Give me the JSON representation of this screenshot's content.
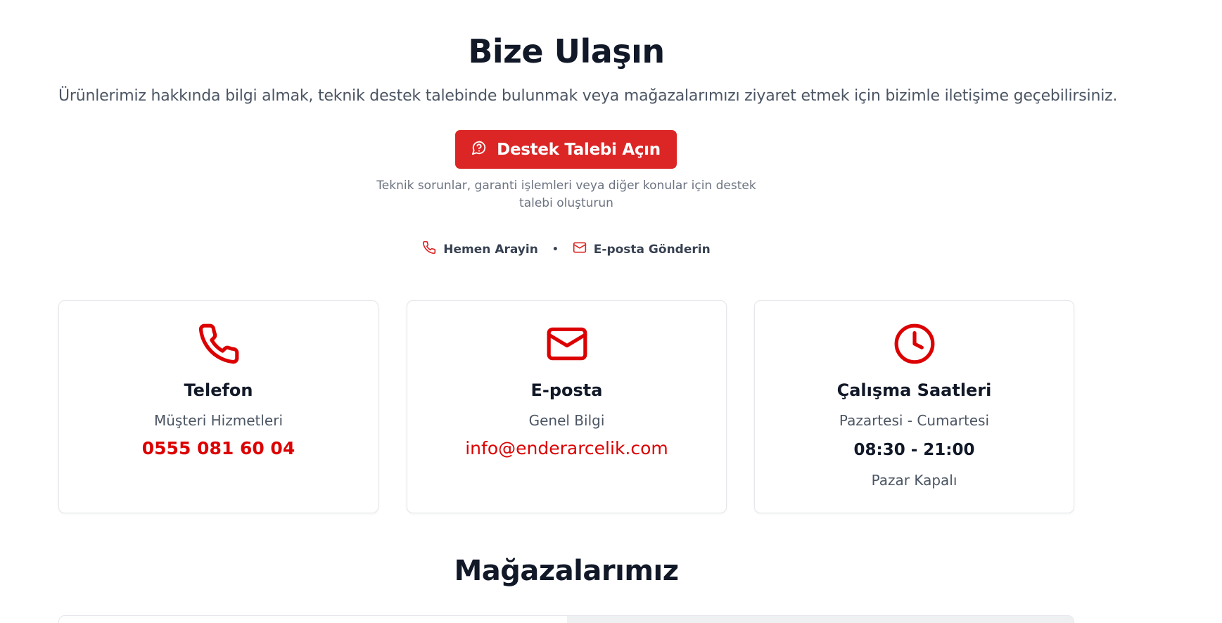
{
  "hero": {
    "title": "Bize Ulaşın",
    "subtitle": "Ürünlerimiz hakkında bilgi almak, teknik destek talebinde bulunmak veya mağazalarımızı ziyaret etmek için bizimle iletişime geçebilirsiniz."
  },
  "cta": {
    "button_label": "Destek Talebi Açın",
    "icon": "support-chat-icon",
    "note": "Teknik sorunlar, garanti işlemleri veya diğer konular için destek talebi oluşturun"
  },
  "quick_links": [
    {
      "label": "Hemen Arayin",
      "icon": "phone-icon"
    },
    {
      "label": "E-posta Gönderin",
      "icon": "mail-icon"
    }
  ],
  "separator": "•",
  "cards": {
    "phone": {
      "icon": "phone-icon",
      "title": "Telefon",
      "subtitle": "Müşteri Hizmetleri",
      "value": "0555 081 60 04"
    },
    "email": {
      "icon": "mail-icon",
      "title": "E-posta",
      "subtitle": "Genel Bilgi",
      "value": "info@enderarcelik.com"
    },
    "hours": {
      "icon": "clock-icon",
      "title": "Çalışma Saatleri",
      "subtitle": "Pazartesi - Cumartesi",
      "value": "08:30 - 21:00",
      "note": "Pazar Kapalı"
    }
  },
  "stores": {
    "title": "Mağazalarımız"
  },
  "colors": {
    "accent": "#dc2626",
    "accent_text": "#dc0000",
    "heading": "#111827",
    "muted": "#4b5563"
  }
}
